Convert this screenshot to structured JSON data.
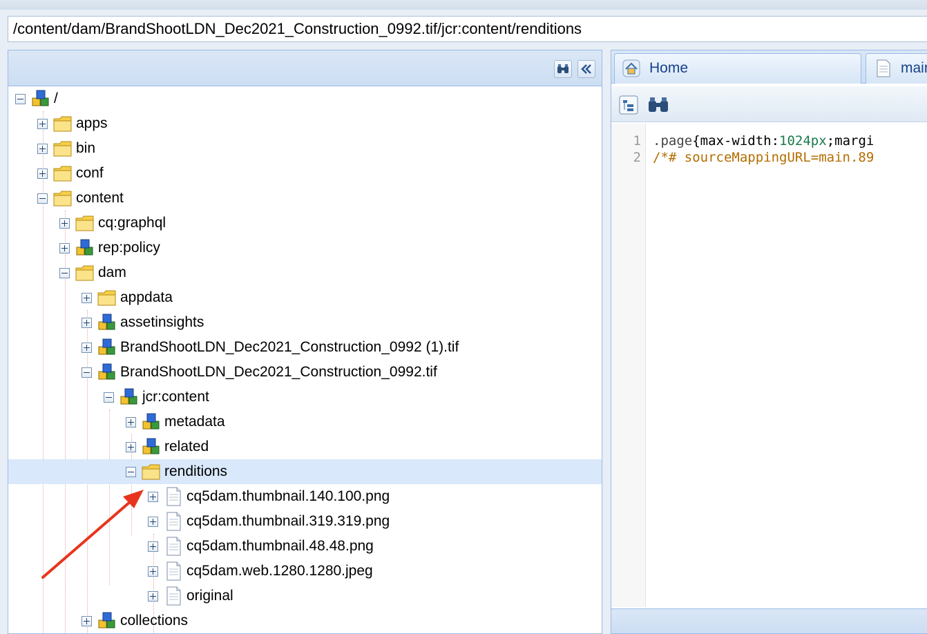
{
  "path": "/content/dam/BrandShootLDN_Dec2021_Construction_0992.tif/jcr:content/renditions",
  "tree_toolbar": {
    "find_icon": "binoculars-icon",
    "collapse_icon": "double-chevron-left-icon"
  },
  "tree": [
    {
      "label": "/",
      "icon": "node",
      "expanded": true
    },
    {
      "label": "apps",
      "icon": "folder",
      "expanded": false
    },
    {
      "label": "bin",
      "icon": "folder",
      "expanded": false
    },
    {
      "label": "conf",
      "icon": "folder",
      "expanded": false
    },
    {
      "label": "content",
      "icon": "folder",
      "expanded": true
    },
    {
      "label": "cq:graphql",
      "icon": "folder",
      "expanded": false
    },
    {
      "label": "rep:policy",
      "icon": "node",
      "expanded": false
    },
    {
      "label": "dam",
      "icon": "folder",
      "expanded": true
    },
    {
      "label": "appdata",
      "icon": "folder",
      "expanded": false
    },
    {
      "label": "assetinsights",
      "icon": "node",
      "expanded": false
    },
    {
      "label": "BrandShootLDN_Dec2021_Construction_0992 (1).tif",
      "icon": "node",
      "expanded": false
    },
    {
      "label": "BrandShootLDN_Dec2021_Construction_0992.tif",
      "icon": "node",
      "expanded": true
    },
    {
      "label": "jcr:content",
      "icon": "node",
      "expanded": true
    },
    {
      "label": "metadata",
      "icon": "node",
      "expanded": false
    },
    {
      "label": "related",
      "icon": "node",
      "expanded": false
    },
    {
      "label": "renditions",
      "icon": "folder",
      "expanded": true,
      "selected": true
    },
    {
      "label": "cq5dam.thumbnail.140.100.png",
      "icon": "file",
      "expanded": false
    },
    {
      "label": "cq5dam.thumbnail.319.319.png",
      "icon": "file",
      "expanded": false
    },
    {
      "label": "cq5dam.thumbnail.48.48.png",
      "icon": "file",
      "expanded": false
    },
    {
      "label": "cq5dam.web.1280.1280.jpeg",
      "icon": "file",
      "expanded": false
    },
    {
      "label": "original",
      "icon": "file",
      "expanded": false
    },
    {
      "label": "collections",
      "icon": "node",
      "expanded": false
    }
  ],
  "tabs": [
    {
      "label": "Home",
      "icon": "home-icon"
    },
    {
      "label": "main",
      "icon": "file-icon"
    }
  ],
  "editor": {
    "line_numbers": [
      "1",
      "2"
    ],
    "line1": {
      "selector": ".page",
      "brace": "{max-width:",
      "number": "1024px",
      "rest": ";margi"
    },
    "line2": {
      "comment": "/*# sourceMappingURL=main.89"
    }
  },
  "colors": {
    "selected_row": "#d9e8fb",
    "panel_border": "#99bbe8",
    "annotation_arrow": "#e8341c"
  }
}
